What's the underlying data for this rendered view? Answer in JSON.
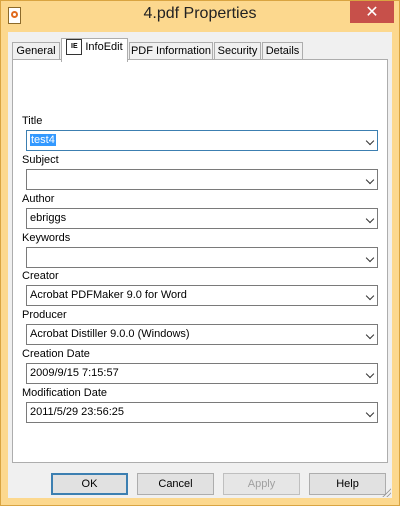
{
  "window": {
    "title": "4.pdf Properties",
    "close_glyph": "✕"
  },
  "tabs": [
    {
      "label": "General"
    },
    {
      "label": "InfoEdit",
      "icon_text": "IE",
      "active": true
    },
    {
      "label": "PDF Information"
    },
    {
      "label": "Security"
    },
    {
      "label": "Details"
    }
  ],
  "fields": [
    {
      "label": "Title",
      "value": "test4",
      "selected": true
    },
    {
      "label": "Subject",
      "value": ""
    },
    {
      "label": "Author",
      "value": "ebriggs"
    },
    {
      "label": "Keywords",
      "value": ""
    },
    {
      "label": "Creator",
      "value": "Acrobat PDFMaker 9.0 for Word"
    },
    {
      "label": "Producer",
      "value": "Acrobat Distiller 9.0.0 (Windows)"
    },
    {
      "label": "Creation Date",
      "value": "2009/9/15 7:15:57"
    },
    {
      "label": "Modification Date",
      "value": "2011/5/29 23:56:25"
    }
  ],
  "buttons": {
    "ok": "OK",
    "cancel": "Cancel",
    "apply": "Apply",
    "help": "Help"
  },
  "colors": {
    "frame": "#fcd88e",
    "close": "#c7504a",
    "selection": "#3399ff"
  }
}
